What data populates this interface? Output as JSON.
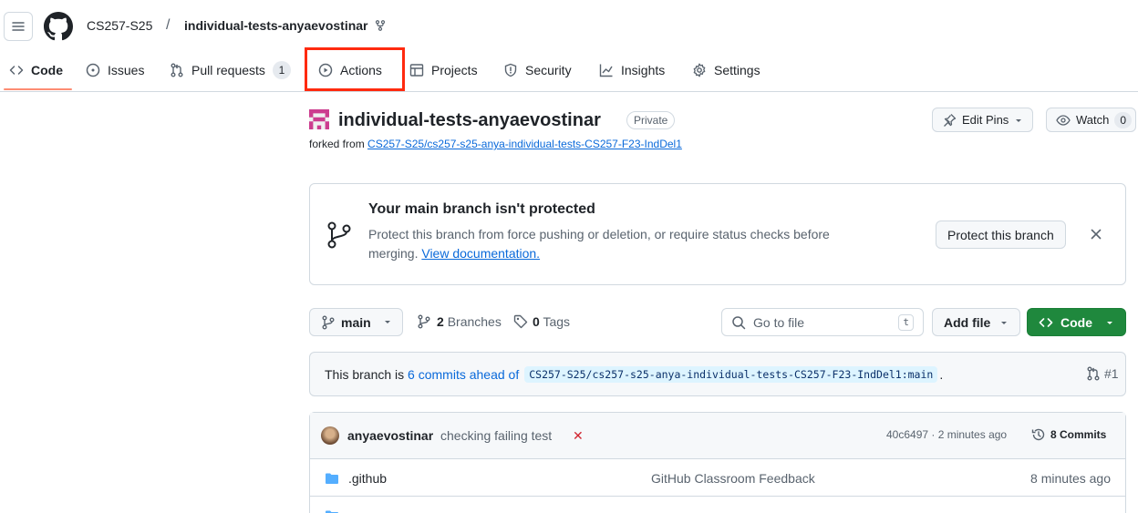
{
  "header": {
    "owner": "CS257-S25",
    "separator": "/",
    "repo": "individual-tests-anyaevostinar"
  },
  "tabs": [
    {
      "label": "Code",
      "icon": "code-icon"
    },
    {
      "label": "Issues",
      "icon": "issue-icon"
    },
    {
      "label": "Pull requests",
      "icon": "pull-request-icon",
      "count": "1"
    },
    {
      "label": "Actions",
      "icon": "play-icon"
    },
    {
      "label": "Projects",
      "icon": "table-icon"
    },
    {
      "label": "Security",
      "icon": "shield-icon"
    },
    {
      "label": "Insights",
      "icon": "graph-icon"
    },
    {
      "label": "Settings",
      "icon": "gear-icon"
    }
  ],
  "repo": {
    "title": "individual-tests-anyaevostinar",
    "visibility": "Private",
    "forked_prefix": "forked from",
    "forked_link": "CS257-S25/cs257-s25-anya-individual-tests-CS257-F23-IndDel1",
    "edit_pins": "Edit Pins",
    "watch": "Watch",
    "watch_count": "0"
  },
  "protect": {
    "title": "Your main branch isn't protected",
    "desc": "Protect this branch from force pushing or deletion, or require status checks before merging.",
    "doc_link": "View documentation.",
    "button": "Protect this branch"
  },
  "branchbar": {
    "branch": "main",
    "branches_count": "2",
    "branches_label": "Branches",
    "tags_count": "0",
    "tags_label": "Tags",
    "goto_placeholder": "Go to file",
    "goto_kbd": "t",
    "add_file": "Add file",
    "code": "Code"
  },
  "ahead": {
    "prefix": "This branch is",
    "link": "6 commits ahead of",
    "ref": "CS257-S25/cs257-s25-anya-individual-tests-CS257-F23-IndDel1:main",
    "suffix": ".",
    "pr": "#1"
  },
  "commit": {
    "user": "anyaevostinar",
    "message": "checking failing test",
    "status": "✕",
    "meta": "40c6497 · 2 minutes ago",
    "count": "8 Commits"
  },
  "files": [
    {
      "name": ".github",
      "message": "GitHub Classroom Feedback",
      "age": "8 minutes ago"
    }
  ],
  "colors": {
    "accent_green": "#1f883d",
    "link_blue": "#0969da",
    "highlight_red": "#ff2a0f",
    "tab_underline": "#fd8c73"
  }
}
